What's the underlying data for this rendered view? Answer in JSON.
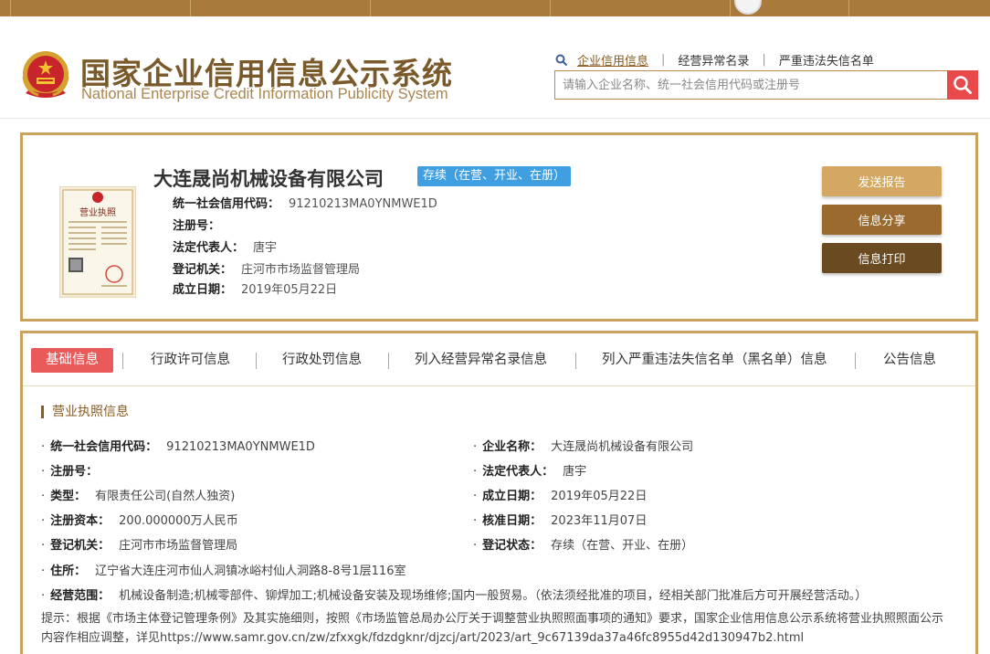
{
  "header": {
    "title_cn": "国家企业信用信息公示系统",
    "title_en": "National Enterprise Credit Information Publicity System",
    "quick_links": [
      {
        "label": "企业信用信息",
        "active": true
      },
      {
        "label": "经营异常名录",
        "active": false
      },
      {
        "label": "严重违法失信名单",
        "active": false
      }
    ],
    "search_placeholder": "请输入企业名称、统一社会信用代码或注册号",
    "accent_color": "#c9a25e",
    "search_button_color": "#e8494a"
  },
  "company": {
    "name": "大连晟尚机械设备有限公司",
    "status_badge": "存续（在营、开业、在册）",
    "fields": [
      {
        "label": "统一社会信用代码：",
        "value": "91210213MA0YNMWE1D"
      },
      {
        "label": "注册号：",
        "value": ""
      },
      {
        "label": "法定代表人：",
        "value": "唐宇"
      },
      {
        "label": "登记机关：",
        "value": "庄河市市场监督管理局"
      },
      {
        "label": "成立日期：",
        "value": "2019年05月22日"
      }
    ],
    "license_icon": "business-license-icon"
  },
  "actions": {
    "send_report": "发送报告",
    "share": "信息分享",
    "print": "信息打印"
  },
  "tabs": [
    {
      "label": "基础信息",
      "active": true
    },
    {
      "label": "行政许可信息",
      "active": false
    },
    {
      "label": "行政处罚信息",
      "active": false
    },
    {
      "label": "列入经营异常名录信息",
      "active": false
    },
    {
      "label": "列入严重违法失信名单（黑名单）信息",
      "active": false
    },
    {
      "label": "公告信息",
      "active": false
    }
  ],
  "license_section": {
    "title": "营业执照信息",
    "left": [
      {
        "label": "统一社会信用代码：",
        "value": "91210213MA0YNMWE1D"
      },
      {
        "label": "注册号：",
        "value": ""
      },
      {
        "label": "类型：",
        "value": "有限责任公司(自然人独资)"
      },
      {
        "label": "注册资本：",
        "value": "200.000000万人民币"
      },
      {
        "label": "登记机关：",
        "value": "庄河市市场监督管理局"
      }
    ],
    "right": [
      {
        "label": "企业名称：",
        "value": "大连晟尚机械设备有限公司"
      },
      {
        "label": "法定代表人：",
        "value": "唐宇"
      },
      {
        "label": "成立日期：",
        "value": "2019年05月22日"
      },
      {
        "label": "核准日期：",
        "value": "2023年11月07日"
      },
      {
        "label": "登记状态：",
        "value": "存续（在营、开业、在册）"
      }
    ],
    "address": {
      "label": "住所：",
      "value": "辽宁省大连庄河市仙人洞镇冰峪村仙人洞路8-8号1层116室"
    },
    "scope": {
      "label": "经营范围：",
      "value": "机械设备制造;机械零部件、铆焊加工;机械设备安装及现场维修;国内一般贸易。（依法须经批准的项目，经相关部门批准后方可开展经营活动。）"
    },
    "notice": "提示：根据《市场主体登记管理条例》及其实施细则，按照《市场监管总局办公厅关于调整营业执照照面事项的通知》要求，国家企业信用信息公示系统将营业执照照面公示内容作相应调整，详见https://www.samr.gov.cn/zw/zfxxgk/fdzdgknr/djzcj/art/2023/art_9c67139da37a46fc8955d42d130947b2.html"
  }
}
